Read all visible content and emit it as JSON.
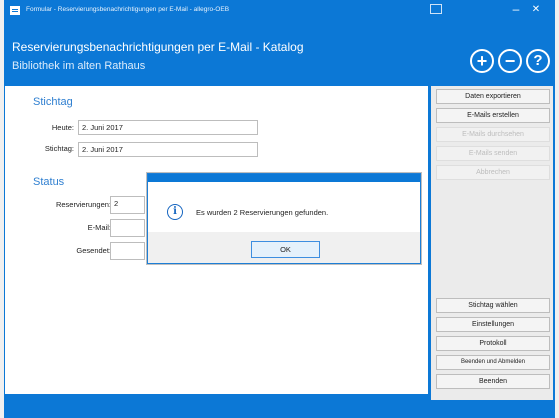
{
  "window": {
    "title": "Formular - Reservierungsbenachrichtigungen per E-Mail - allegro-OEB"
  },
  "header": {
    "line1": "Reservierungsbenachrichtigungen per E-Mail - Katalog",
    "line2": "Bibliothek im alten Rathaus",
    "buttons": {
      "plus": "+",
      "minus": "−",
      "help": "?"
    }
  },
  "stichtag": {
    "title": "Stichtag",
    "heute_label": "Heute:",
    "heute_value": "2. Juni 2017",
    "stichtag_label": "Stichtag:",
    "stichtag_value": "2. Juni 2017"
  },
  "status": {
    "title": "Status",
    "reservierungen_label": "Reservierungen:",
    "reservierungen_value": "2",
    "email_label": "E-Mail:",
    "email_value": "",
    "gesendet_label": "Gesendet:",
    "gesendet_value": ""
  },
  "side_buttons_top": [
    {
      "label": "Daten exportieren",
      "enabled": true
    },
    {
      "label": "E-Mails erstellen",
      "enabled": true
    },
    {
      "label": "E-Mails durchsehen",
      "enabled": false
    },
    {
      "label": "E-Mails senden",
      "enabled": false
    },
    {
      "label": "Abbrechen",
      "enabled": false
    }
  ],
  "side_buttons_bottom": [
    {
      "label": "Stichtag wählen"
    },
    {
      "label": "Einstellungen"
    },
    {
      "label": "Protokoll"
    },
    {
      "label": "Beenden und Abmelden"
    },
    {
      "label": "Beenden"
    }
  ],
  "dialog": {
    "message": "Es wurden 2 Reservierungen gefunden.",
    "ok_label": "OK",
    "icon": "info-icon"
  },
  "colors": {
    "accent": "#0c78d6",
    "section_title": "#2f7fd0"
  }
}
